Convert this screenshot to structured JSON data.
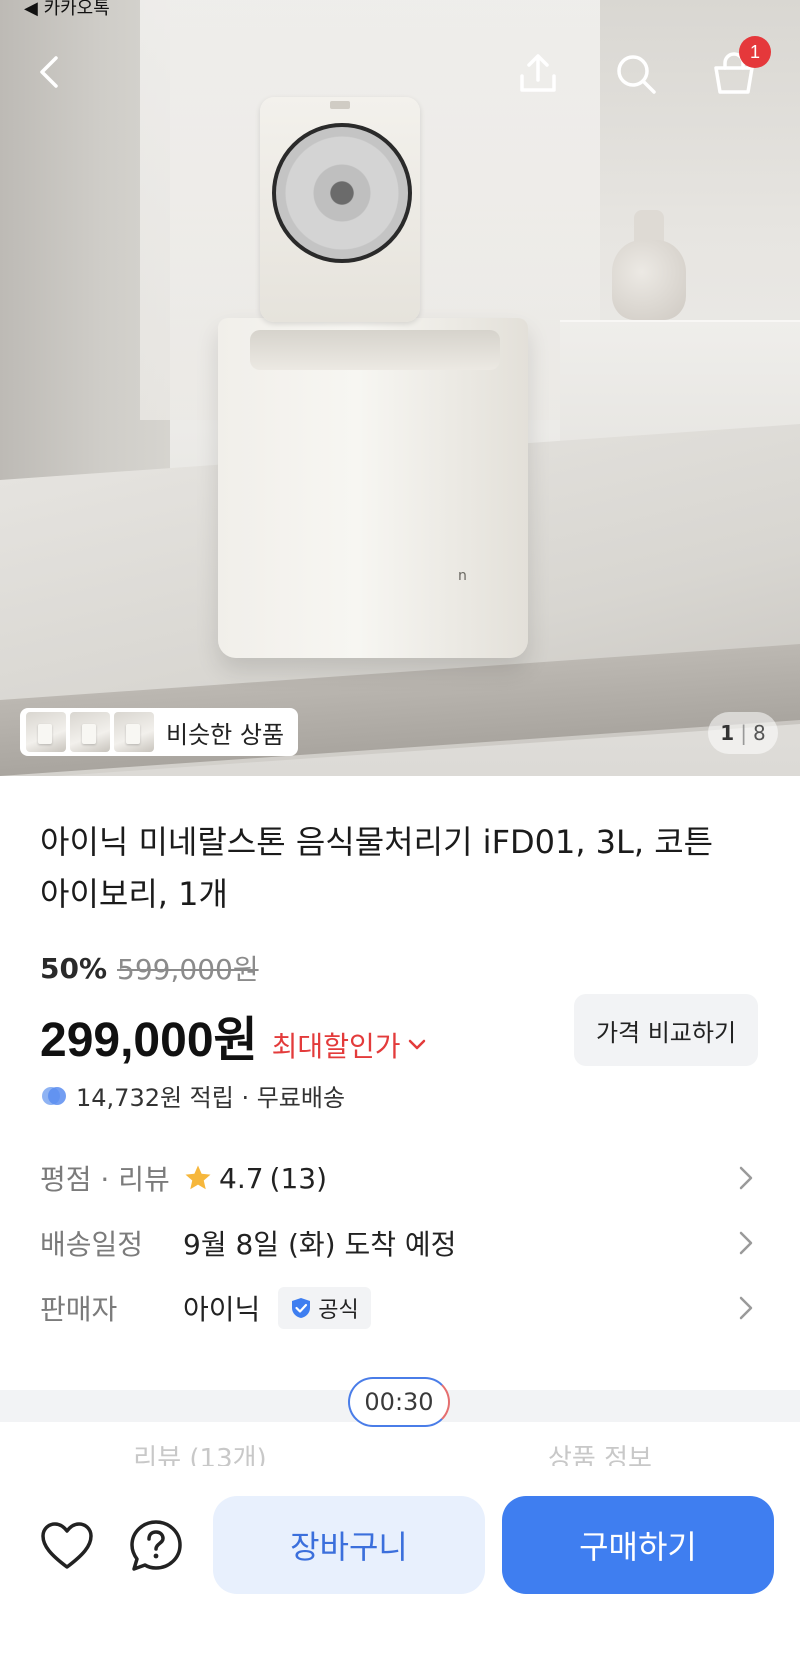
{
  "status_bar": {
    "back_app": "◀ 카카오톡"
  },
  "header": {
    "cart_badge": "1"
  },
  "gallery": {
    "similar_label": "비슷한 상품",
    "current": "1",
    "total": "8"
  },
  "product": {
    "title": "아이닉 미네랄스톤 음식물처리기 iFD01, 3L, 코튼 아이보리, 1개",
    "discount_rate": "50%",
    "original_price": "599,000원",
    "price": "299,000원",
    "max_discount_label": "최대할인가",
    "compare_button": "가격 비교하기",
    "points": "14,732원 적립 · 무료배송"
  },
  "info": {
    "rating": {
      "key": "평점 · 리뷰",
      "score": "4.7",
      "count": "(13)"
    },
    "delivery": {
      "key": "배송일정",
      "value": "9월 8일 (화) 도착 예정"
    },
    "seller": {
      "key": "판매자",
      "value": "아이닉",
      "official": "공식"
    }
  },
  "timer": "00:30",
  "tabs": [
    "리뷰 (13개)",
    "상품 정보"
  ],
  "bottom": {
    "cart": "장바구니",
    "buy": "구매하기"
  },
  "colors": {
    "accent": "#3f7ef0",
    "discount_red": "#e33b3b",
    "star": "#f6b73c"
  }
}
